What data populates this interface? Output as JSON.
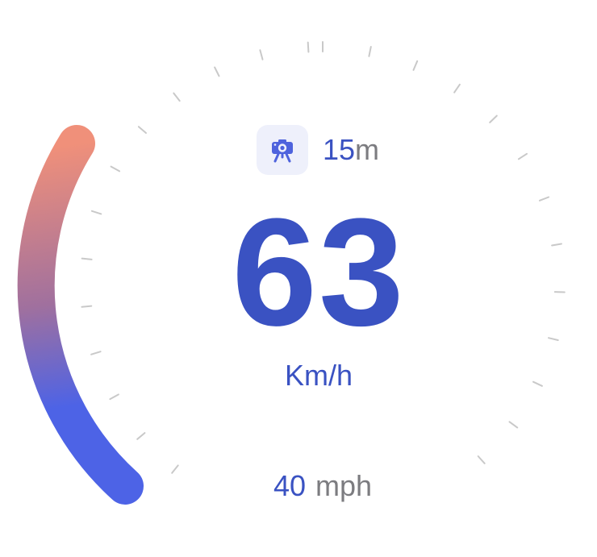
{
  "colors": {
    "primary": "#3a52c2",
    "secondary_text": "#7c7c80",
    "badge_bg": "#eef0fb",
    "camera_icon": "#4e63dd",
    "tick": "#c9c9c9",
    "arc_start": "#f0907a",
    "arc_mid": "#a0709e",
    "arc_end": "#4d63e6"
  },
  "camera_alert": {
    "icon": "speed-camera-icon",
    "distance_value": "15",
    "distance_unit": "m"
  },
  "speed": {
    "value": "63",
    "unit": "Km/h",
    "progress": 0.33
  },
  "speed_limit": {
    "value": "40",
    "unit": "mph"
  }
}
